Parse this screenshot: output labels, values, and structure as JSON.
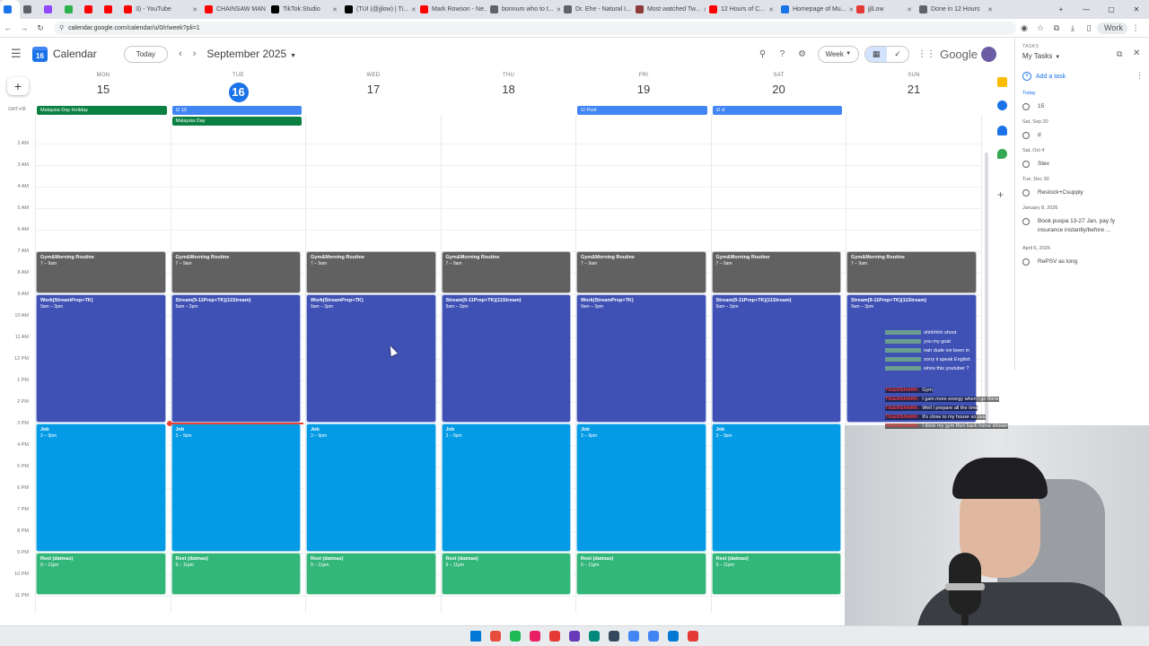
{
  "browser": {
    "tabs": [
      {
        "title": "",
        "color": "#1a73e8"
      },
      {
        "title": "",
        "color": "#5f6368"
      },
      {
        "title": "",
        "color": "#9146ff"
      },
      {
        "title": "",
        "color": "#2bb24c"
      },
      {
        "title": "",
        "color": "#ff0000"
      },
      {
        "title": "",
        "color": "#ff0000"
      },
      {
        "title": "3) - YouTube",
        "color": "#ff0000"
      },
      {
        "title": "CHAINSAW MAN",
        "color": "#ff0000"
      },
      {
        "title": "TikTok Studio",
        "color": "#000000"
      },
      {
        "title": "(TUI (@jjlow) | Ti...",
        "color": "#000000"
      },
      {
        "title": "Mark Rowson - Ne...",
        "color": "#ff0000"
      },
      {
        "title": "bonnum who to t...",
        "color": "#5f6368"
      },
      {
        "title": "Dr. Ehe - Natural I...",
        "color": "#5f6368"
      },
      {
        "title": "Most watched Tw...",
        "color": "#8d3a3a"
      },
      {
        "title": "12 Hours of C...",
        "color": "#ff0000"
      },
      {
        "title": "Homepage of Mu...",
        "color": "#1a73e8"
      },
      {
        "title": "jjlLow",
        "color": "#e53935"
      },
      {
        "title": "Done in 12 Hours",
        "color": "#5f6368"
      }
    ],
    "url": "calendar.google.com/calendar/u/0/r/week?pli=1",
    "profile": "Work"
  },
  "header": {
    "app_title": "Calendar",
    "logo_number": "16",
    "today_label": "Today",
    "month_title": "September 2025",
    "view_label": "Week",
    "google_label": "Google"
  },
  "days": [
    {
      "name": "MON",
      "num": "15",
      "today": false
    },
    {
      "name": "TUE",
      "num": "16",
      "today": true
    },
    {
      "name": "WED",
      "num": "17",
      "today": false
    },
    {
      "name": "THU",
      "num": "18",
      "today": false
    },
    {
      "name": "FRI",
      "num": "19",
      "today": false
    },
    {
      "name": "SAT",
      "num": "20",
      "today": false
    },
    {
      "name": "SUN",
      "num": "21",
      "today": false
    }
  ],
  "timezone": "GMT+08",
  "allday": [
    {
      "day": 0,
      "row": 0,
      "span": 1,
      "label": "Malaysia Day Holiday",
      "color": "#0b8043"
    },
    {
      "day": 1,
      "row": 0,
      "span": 1,
      "label": "15",
      "color": "#4285f4",
      "task": true
    },
    {
      "day": 1,
      "row": 1,
      "span": 1,
      "label": "Malaysia Day",
      "color": "#0b8043"
    },
    {
      "day": 4,
      "row": 0,
      "span": 1,
      "label": "Post",
      "color": "#4285f4",
      "task": true
    },
    {
      "day": 5,
      "row": 0,
      "span": 1,
      "label": "d",
      "color": "#4285f4",
      "task": true
    }
  ],
  "hours": [
    "2 AM",
    "3 AM",
    "4 AM",
    "5 AM",
    "6 AM",
    "7 AM",
    "8 AM",
    "9 AM",
    "10 AM",
    "11 AM",
    "12 PM",
    "1 PM",
    "2 PM",
    "3 PM",
    "4 PM",
    "5 PM",
    "6 PM",
    "7 PM",
    "8 PM",
    "9 PM",
    "10 PM",
    "11 PM"
  ],
  "events": [
    {
      "day": 0,
      "start": 7,
      "end": 9,
      "title": "Gym&Morning Routine",
      "time": "7 – 9am",
      "color": "#616161"
    },
    {
      "day": 1,
      "start": 7,
      "end": 9,
      "title": "Gym&Morning Routine",
      "time": "7 – 9am",
      "color": "#616161"
    },
    {
      "day": 2,
      "start": 7,
      "end": 9,
      "title": "Gym&Morning Routine",
      "time": "7 – 9am",
      "color": "#616161"
    },
    {
      "day": 3,
      "start": 7,
      "end": 9,
      "title": "Gym&Morning Routine",
      "time": "7 – 9am",
      "color": "#616161"
    },
    {
      "day": 4,
      "start": 7,
      "end": 9,
      "title": "Gym&Morning Routine",
      "time": "7 – 9am",
      "color": "#616161"
    },
    {
      "day": 5,
      "start": 7,
      "end": 9,
      "title": "Gym&Morning Routine",
      "time": "7 – 9am",
      "color": "#616161"
    },
    {
      "day": 6,
      "start": 7,
      "end": 9,
      "title": "Gym&Morning Routine",
      "time": "7 – 9am",
      "color": "#616161"
    },
    {
      "day": 0,
      "start": 9,
      "end": 15,
      "title": "Work(StreamPrep+TK)",
      "time": "9am – 3pm",
      "color": "#3f51b5"
    },
    {
      "day": 1,
      "start": 9,
      "end": 15,
      "title": "Stream(9-11Prep+TK)(11Stream)",
      "time": "9am – 3pm",
      "color": "#3f51b5"
    },
    {
      "day": 2,
      "start": 9,
      "end": 15,
      "title": "Work(StreamPrep+TK)",
      "time": "9am – 3pm",
      "color": "#3f51b5"
    },
    {
      "day": 3,
      "start": 9,
      "end": 15,
      "title": "Stream(9-11Prep+TK)(11Stream)",
      "time": "9am – 3pm",
      "color": "#3f51b5"
    },
    {
      "day": 4,
      "start": 9,
      "end": 15,
      "title": "Work(StreamPrep+TK)",
      "time": "9am – 3pm",
      "color": "#3f51b5"
    },
    {
      "day": 5,
      "start": 9,
      "end": 15,
      "title": "Stream(9-11Prep+TK)(11Stream)",
      "time": "9am – 3pm",
      "color": "#3f51b5"
    },
    {
      "day": 6,
      "start": 9,
      "end": 15,
      "title": "Stream(9-11Prep+TK)(11Stream)",
      "time": "9am – 3pm",
      "color": "#3f51b5"
    },
    {
      "day": 0,
      "start": 15,
      "end": 21,
      "title": "Job",
      "time": "3 – 9pm",
      "color": "#039be5"
    },
    {
      "day": 1,
      "start": 15,
      "end": 21,
      "title": "Job",
      "time": "3 – 9pm",
      "color": "#039be5"
    },
    {
      "day": 2,
      "start": 15,
      "end": 21,
      "title": "Job",
      "time": "3 – 9pm",
      "color": "#039be5"
    },
    {
      "day": 3,
      "start": 15,
      "end": 21,
      "title": "Job",
      "time": "3 – 9pm",
      "color": "#039be5"
    },
    {
      "day": 4,
      "start": 15,
      "end": 21,
      "title": "Job",
      "time": "3 – 9pm",
      "color": "#039be5"
    },
    {
      "day": 5,
      "start": 15,
      "end": 21,
      "title": "Job",
      "time": "3 – 9pm",
      "color": "#039be5"
    },
    {
      "day": 0,
      "start": 21,
      "end": 23,
      "title": "Rest (datmax)",
      "time": "9 – 11pm",
      "color": "#33b679"
    },
    {
      "day": 1,
      "start": 21,
      "end": 23,
      "title": "Rest (datmax)",
      "time": "9 – 11pm",
      "color": "#33b679"
    },
    {
      "day": 2,
      "start": 21,
      "end": 23,
      "title": "Rest (datmax)",
      "time": "9 – 11pm",
      "color": "#33b679"
    },
    {
      "day": 3,
      "start": 21,
      "end": 23,
      "title": "Rest (datmax)",
      "time": "9 – 11pm",
      "color": "#33b679"
    },
    {
      "day": 4,
      "start": 21,
      "end": 23,
      "title": "Rest (datmax)",
      "time": "9 – 11pm",
      "color": "#33b679"
    },
    {
      "day": 5,
      "start": 21,
      "end": 23,
      "title": "Rest (datmax)",
      "time": "9 – 11pm",
      "color": "#33b679"
    }
  ],
  "now_hour": 15,
  "tasks": {
    "section_label": "TASKS",
    "list_name": "My Tasks",
    "add_label": "Add a task",
    "groups": [
      {
        "label": "Today",
        "highlight": true,
        "items": [
          "15"
        ]
      },
      {
        "label": "Sat, Sep 20",
        "highlight": false,
        "items": [
          "d"
        ]
      },
      {
        "label": "Sat, Oct 4",
        "highlight": false,
        "items": [
          "Stev"
        ]
      },
      {
        "label": "Tue, Dec 30",
        "highlight": false,
        "items": [
          "Restock+Csupply"
        ]
      },
      {
        "label": "January 8, 2026",
        "highlight": false,
        "items": [
          "Book puspa 13-27 Jan, pay fy insurance instantly/before ..."
        ]
      },
      {
        "label": "April 6, 2026",
        "highlight": false,
        "items": [
          "RePSV as long"
        ]
      }
    ]
  },
  "chat": [
    {
      "user": "",
      "msg": "ohhhhhh shoot",
      "color": "#7fbf7f"
    },
    {
      "user": "",
      "msg": "you my goat",
      "color": "#7fbf7f"
    },
    {
      "user": "",
      "msg": "nah dude ive been in",
      "color": "#7fbf7f"
    },
    {
      "user": "",
      "msg": "sorry ii speak English",
      "color": "#7fbf7f"
    },
    {
      "user": "",
      "msg": "whos this youtuber ?",
      "color": "#7fbf7f"
    },
    {
      "user": "TIGERSHARK",
      "msg": "Gym",
      "color": "#ff3b3b"
    },
    {
      "user": "TIGERSHARK",
      "msg": "I gain more energy when I go there",
      "color": "#ff3b3b"
    },
    {
      "user": "TIGERSHARK",
      "msg": "Well I prepare all the time",
      "color": "#ff3b3b"
    },
    {
      "user": "TIGERSHARK",
      "msg": "It's close to my house so usa",
      "color": "#ff3b3b"
    },
    {
      "user": "TIGERSHARK",
      "msg": "I done my gym then back home shower",
      "color": "#ff3b3b"
    }
  ],
  "taskbar_icons": [
    {
      "color": "#0078d4"
    },
    {
      "color": "#e74c3c"
    },
    {
      "color": "#1db954"
    },
    {
      "color": "#e91e63"
    },
    {
      "color": "#e53935"
    },
    {
      "color": "#673ab7"
    },
    {
      "color": "#00897b"
    },
    {
      "color": "#34495e"
    },
    {
      "color": "#4285f4"
    },
    {
      "color": "#4285f4"
    },
    {
      "color": "#0078d4"
    },
    {
      "color": "#e53935"
    }
  ]
}
